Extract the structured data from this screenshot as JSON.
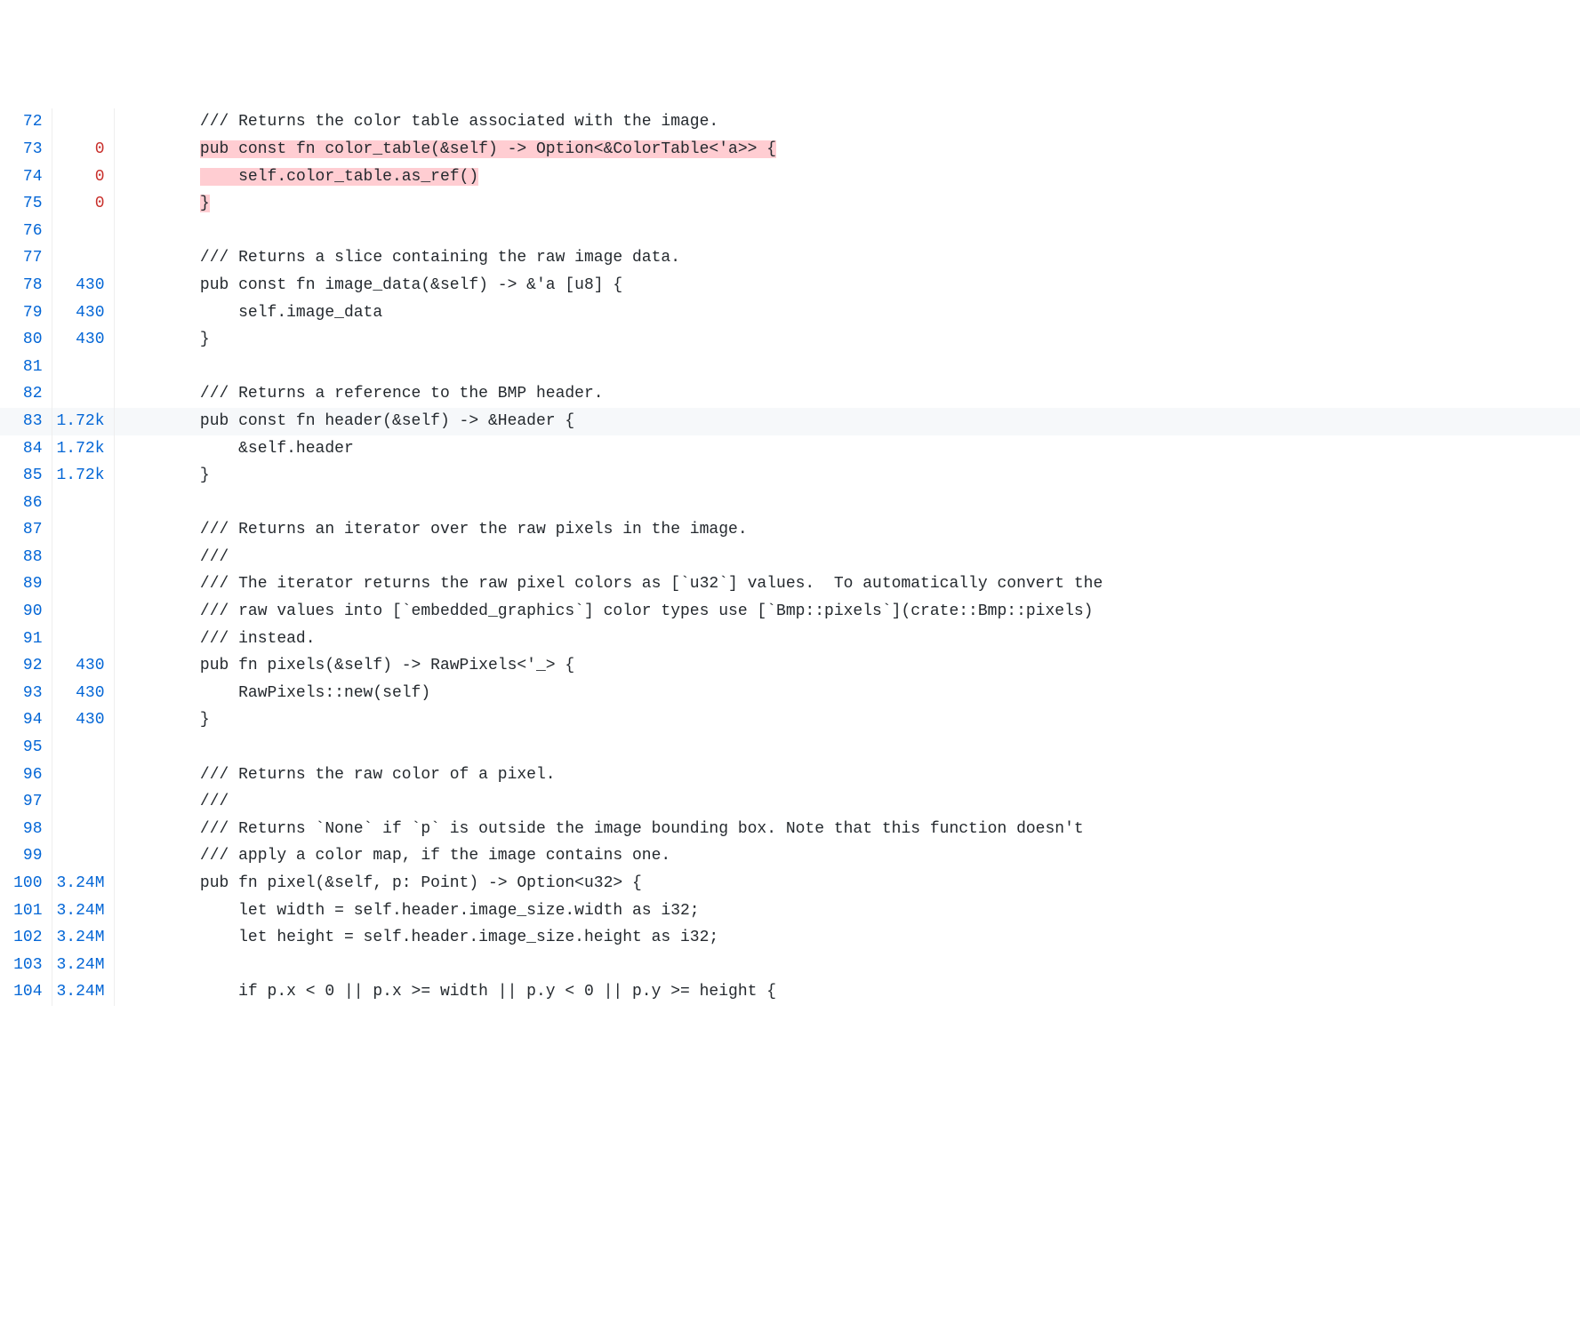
{
  "lines": [
    {
      "num": "72",
      "count": "",
      "code": "        /// Returns the color table associated with the image.",
      "type": "plain"
    },
    {
      "num": "73",
      "count": "0",
      "countClass": "zero",
      "code": "        ",
      "hl": "pub const fn color_table(&self) -> Option<&ColorTable<'a>> {",
      "type": "hl"
    },
    {
      "num": "74",
      "count": "0",
      "countClass": "zero",
      "code": "        ",
      "hlpad": "    ",
      "hl": "self.color_table.as_ref()",
      "type": "hl2"
    },
    {
      "num": "75",
      "count": "0",
      "countClass": "zero",
      "code": "        ",
      "hlpad": "",
      "hl": "}",
      "type": "hl2"
    },
    {
      "num": "76",
      "count": "",
      "code": "",
      "type": "plain"
    },
    {
      "num": "77",
      "count": "",
      "code": "        /// Returns a slice containing the raw image data.",
      "type": "plain"
    },
    {
      "num": "78",
      "count": "430",
      "code": "        pub const fn image_data(&self) -> &'a [u8] {",
      "type": "plain"
    },
    {
      "num": "79",
      "count": "430",
      "code": "            self.image_data",
      "type": "plain"
    },
    {
      "num": "80",
      "count": "430",
      "code": "        }",
      "type": "plain"
    },
    {
      "num": "81",
      "count": "",
      "code": "",
      "type": "plain"
    },
    {
      "num": "82",
      "count": "",
      "code": "        /// Returns a reference to the BMP header.",
      "type": "plain"
    },
    {
      "num": "83",
      "count": "1.72k",
      "code": "        pub const fn header(&self) -> &Header {",
      "type": "plain",
      "hover": true
    },
    {
      "num": "84",
      "count": "1.72k",
      "code": "            &self.header",
      "type": "plain"
    },
    {
      "num": "85",
      "count": "1.72k",
      "code": "        }",
      "type": "plain"
    },
    {
      "num": "86",
      "count": "",
      "code": "",
      "type": "plain"
    },
    {
      "num": "87",
      "count": "",
      "code": "        /// Returns an iterator over the raw pixels in the image.",
      "type": "plain"
    },
    {
      "num": "88",
      "count": "",
      "code": "        ///",
      "type": "plain"
    },
    {
      "num": "89",
      "count": "",
      "code": "        /// The iterator returns the raw pixel colors as [`u32`] values.  To automatically convert the",
      "type": "plain"
    },
    {
      "num": "90",
      "count": "",
      "code": "        /// raw values into [`embedded_graphics`] color types use [`Bmp::pixels`](crate::Bmp::pixels)",
      "type": "plain"
    },
    {
      "num": "91",
      "count": "",
      "code": "        /// instead.",
      "type": "plain"
    },
    {
      "num": "92",
      "count": "430",
      "code": "        pub fn pixels(&self) -> RawPixels<'_> {",
      "type": "plain"
    },
    {
      "num": "93",
      "count": "430",
      "code": "            RawPixels::new(self)",
      "type": "plain"
    },
    {
      "num": "94",
      "count": "430",
      "code": "        }",
      "type": "plain"
    },
    {
      "num": "95",
      "count": "",
      "code": "",
      "type": "plain"
    },
    {
      "num": "96",
      "count": "",
      "code": "        /// Returns the raw color of a pixel.",
      "type": "plain"
    },
    {
      "num": "97",
      "count": "",
      "code": "        ///",
      "type": "plain"
    },
    {
      "num": "98",
      "count": "",
      "code": "        /// Returns `None` if `p` is outside the image bounding box. Note that this function doesn't",
      "type": "plain"
    },
    {
      "num": "99",
      "count": "",
      "code": "        /// apply a color map, if the image contains one.",
      "type": "plain"
    },
    {
      "num": "100",
      "count": "3.24M",
      "code": "        pub fn pixel(&self, p: Point) -> Option<u32> {",
      "type": "plain"
    },
    {
      "num": "101",
      "count": "3.24M",
      "code": "            let width = self.header.image_size.width as i32;",
      "type": "plain"
    },
    {
      "num": "102",
      "count": "3.24M",
      "code": "            let height = self.header.image_size.height as i32;",
      "type": "plain"
    },
    {
      "num": "103",
      "count": "3.24M",
      "code": "",
      "type": "plain"
    },
    {
      "num": "104",
      "count": "3.24M",
      "code": "            if p.x < 0 || p.x >= width || p.y < 0 || p.y >= height {",
      "type": "plain",
      "cut": true
    }
  ]
}
